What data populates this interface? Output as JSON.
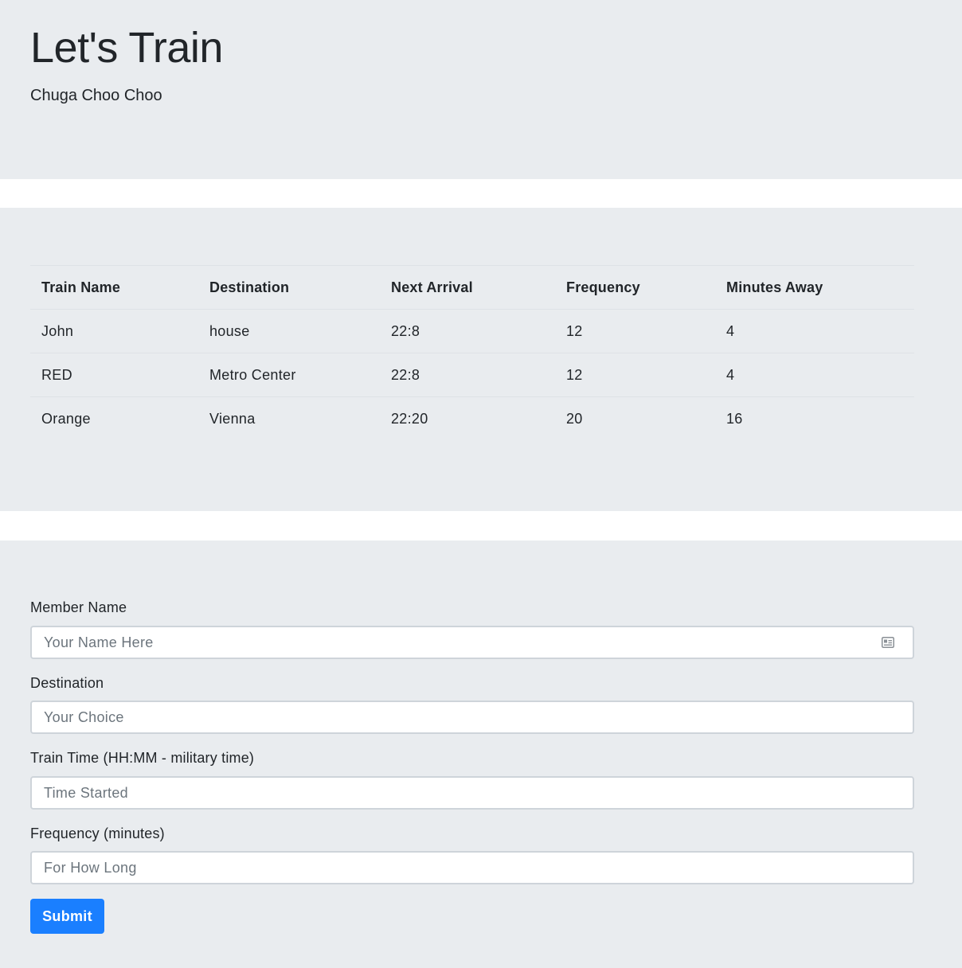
{
  "header": {
    "title": "Let's Train",
    "subtitle": "Chuga Choo Choo"
  },
  "schedule": {
    "columns": [
      "Train Name",
      "Destination",
      "Next Arrival",
      "Frequency",
      "Minutes Away"
    ],
    "rows": [
      [
        "John",
        "house",
        "22:8",
        "12",
        "4"
      ],
      [
        "RED",
        "Metro Center",
        "22:8",
        "12",
        "4"
      ],
      [
        "Orange",
        "Vienna",
        "22:20",
        "20",
        "16"
      ]
    ]
  },
  "form": {
    "fields": [
      {
        "label": "Member Name",
        "placeholder": "Your Name Here",
        "icon": "contact-card-icon"
      },
      {
        "label": "Destination",
        "placeholder": "Your Choice"
      },
      {
        "label": "Train Time (HH:MM - military time)",
        "placeholder": "Time Started"
      },
      {
        "label": "Frequency (minutes)",
        "placeholder": "For How Long"
      }
    ],
    "submit_label": "Submit"
  },
  "colors": {
    "panel_background": "#e9ecef",
    "primary_button": "#1a7fff",
    "text": "#212529"
  }
}
